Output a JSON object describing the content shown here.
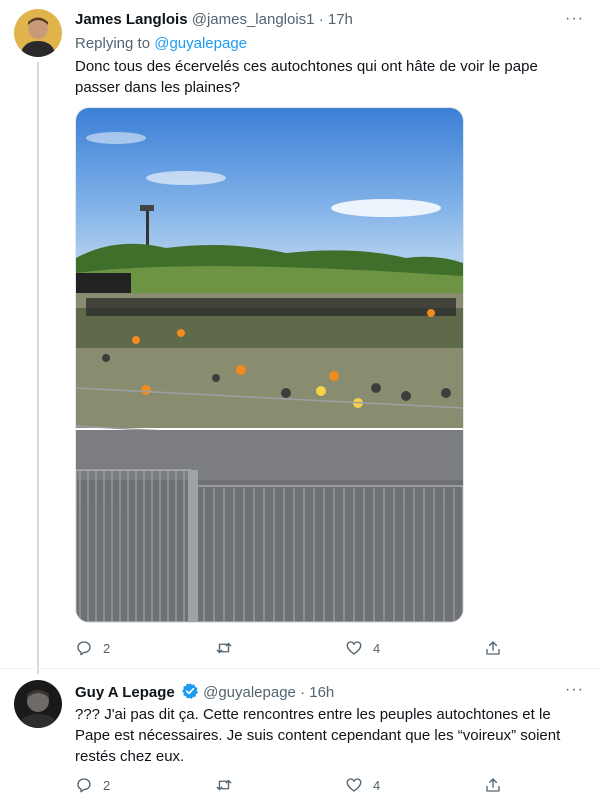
{
  "tweet1": {
    "name": "James Langlois",
    "handle": "@james_langlois1",
    "separator": "·",
    "time": "17h",
    "more": "···",
    "reply_prefix": "Replying to",
    "reply_handle": "@guyalepage",
    "text_line1": "Donc tous des écervelés ces autochtones qui ont hâte de voir le pape",
    "text_line2": "passer dans les plaines?",
    "stats": {
      "replies": "2",
      "retweets": "",
      "likes": "4"
    }
  },
  "tweet2": {
    "name": "Guy A Lepage",
    "handle": "@guyalepage",
    "separator": "·",
    "time": "16h",
    "more": "···",
    "text_line1": "??? J'ai pas dit ça. Cette rencontres entre les peuples autochtones et le",
    "text_line2": "Pape est nécessaires. Je suis content cependant que les “voireux” soient",
    "text_line3": "restés chez eux.",
    "stats": {
      "replies": "2",
      "retweets": "",
      "likes": "4"
    }
  },
  "icons": [
    "reply-icon",
    "retweet-icon",
    "like-icon",
    "share-icon",
    "verified-badge-icon",
    "more-icon"
  ],
  "colors": {
    "accent": "#1d9bf0",
    "muted": "#536471",
    "text": "#0f1419"
  }
}
